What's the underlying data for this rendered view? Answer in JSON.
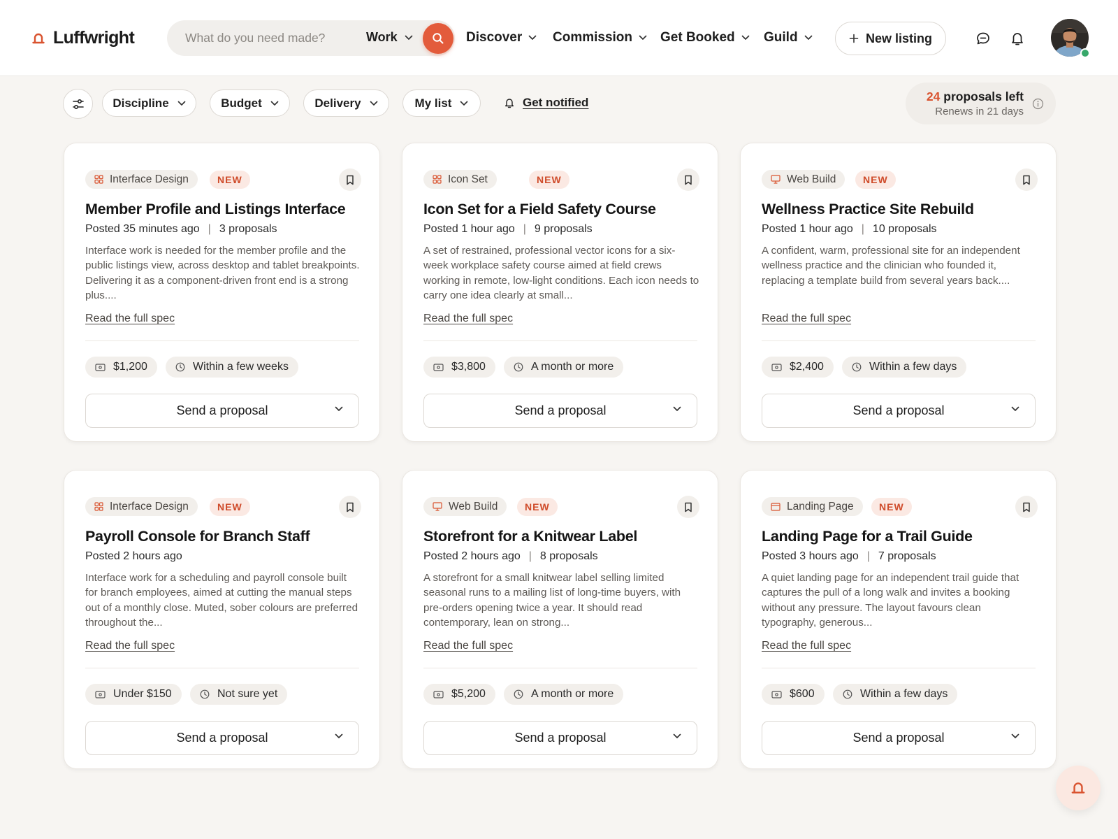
{
  "brand": {
    "name": "Luffwright",
    "accent": "#e35b3b"
  },
  "search": {
    "placeholder": "What do you need made?",
    "scope": "Work"
  },
  "nav": [
    {
      "label": "Discover"
    },
    {
      "label": "Commission"
    },
    {
      "label": "Get Booked"
    },
    {
      "label": "Guild"
    }
  ],
  "header_actions": {
    "new_listing": "New listing"
  },
  "filters": {
    "chips": [
      {
        "label": "Discipline"
      },
      {
        "label": "Budget"
      },
      {
        "label": "Delivery"
      },
      {
        "label": "My list"
      }
    ],
    "get_notified": "Get notified"
  },
  "proposals": {
    "count": "24",
    "label": "proposals left",
    "renews": "Renews in 21 days"
  },
  "card_labels": {
    "new_badge": "NEW",
    "read_more": "Read the full spec",
    "send": "Send a proposal"
  },
  "cards": [
    {
      "category": "Interface Design",
      "category_icon": "grid-icon",
      "title": "Member Profile and Listings Interface",
      "posted": "Posted 35 minutes ago",
      "proposals": "3 proposals",
      "description": "Interface work is needed for the member profile and the public listings view, across desktop and tablet breakpoints. Delivering it as a component-driven front end is a strong plus....",
      "budget": "$1,200",
      "delivery": "Within a few weeks"
    },
    {
      "category": "Icon Set",
      "category_icon": "grid-icon",
      "title": "Icon Set for a Field Safety Course",
      "posted": "Posted 1 hour ago",
      "proposals": "9 proposals",
      "description": "A set of restrained, professional vector icons for a six-week workplace safety course aimed at field crews working in remote, low-light conditions. Each icon needs to carry one idea clearly at small...",
      "budget": "$3,800",
      "delivery": "A month or more"
    },
    {
      "category": "Web Build",
      "category_icon": "monitor-icon",
      "title": "Wellness Practice Site Rebuild",
      "posted": "Posted 1 hour ago",
      "proposals": "10 proposals",
      "description": "A confident, warm, professional site for an independent wellness practice and the clinician who founded it, replacing a template build from several years back....",
      "budget": "$2,400",
      "delivery": "Within a few days"
    },
    {
      "category": "Interface Design",
      "category_icon": "grid-icon",
      "title": "Payroll Console for Branch Staff",
      "posted": "Posted 2 hours ago",
      "proposals": "",
      "description": "Interface work for a scheduling and payroll console built for branch employees, aimed at cutting the manual steps out of a monthly close. Muted, sober colours are preferred throughout the...",
      "budget": "Under $150",
      "delivery": "Not sure yet"
    },
    {
      "category": "Web Build",
      "category_icon": "monitor-icon",
      "title": "Storefront for a Knitwear Label",
      "posted": "Posted 2 hours ago",
      "proposals": "8 proposals",
      "description": "A storefront for a small knitwear label selling limited seasonal runs to a mailing list of long-time buyers, with pre-orders opening twice a year. It should read contemporary, lean on strong...",
      "budget": "$5,200",
      "delivery": "A month or more"
    },
    {
      "category": "Landing Page",
      "category_icon": "browser-icon",
      "title": "Landing Page for a Trail Guide",
      "posted": "Posted 3 hours ago",
      "proposals": "7 proposals",
      "description": "A quiet landing page for an independent trail guide that captures the pull of a long walk and invites a booking without any pressure. The layout favours clean typography, generous...",
      "budget": "$600",
      "delivery": "Within a few days"
    }
  ]
}
